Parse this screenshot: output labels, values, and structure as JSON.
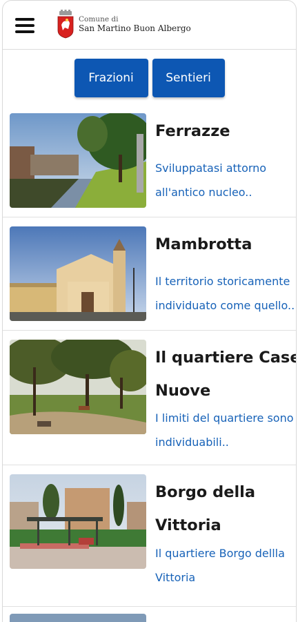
{
  "header": {
    "logo_line1": "Comune di",
    "logo_line2": "San Martino Buon Albergo"
  },
  "tabs": [
    {
      "label": "Frazioni"
    },
    {
      "label": "Sentieri"
    }
  ],
  "items": [
    {
      "title": "Ferrazze",
      "desc_lines": [
        "Sviluppatasi attorno",
        "all'antico nucleo.."
      ]
    },
    {
      "title": "Mambrotta",
      "desc_lines": [
        "Il territorio storicamente",
        "individuato come quello.."
      ]
    },
    {
      "title_lines": [
        "Il quartiere Case",
        "Nuove"
      ],
      "desc_lines": [
        "I limiti del quartiere sono",
        "individuabili.."
      ]
    },
    {
      "title_lines": [
        "Borgo della",
        "Vittoria"
      ],
      "desc_lines": [
        "Il quartiere Borgo dellla",
        "Vittoria"
      ]
    }
  ],
  "colors": {
    "accent": "#0d57b3",
    "link": "#1762b8"
  }
}
